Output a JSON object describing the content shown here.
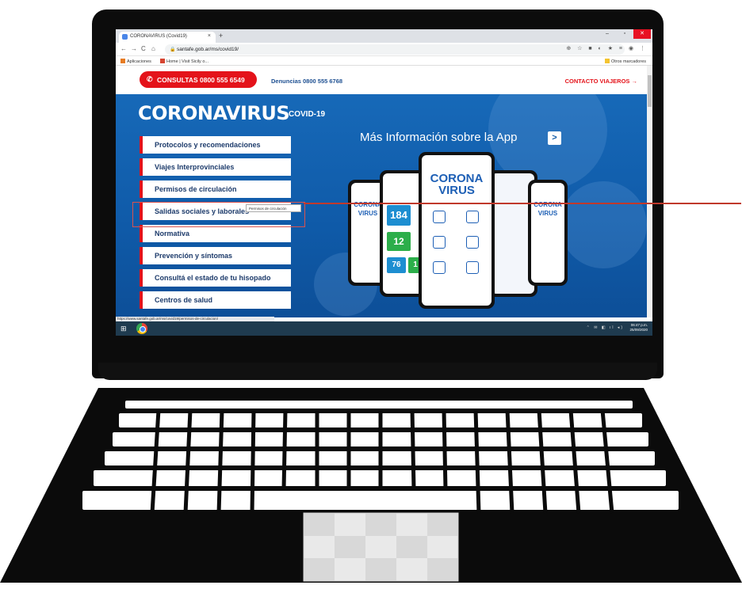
{
  "browser": {
    "tab_title": "CORONAVIRUS (Covid19)",
    "tab_close": "×",
    "new_tab": "+",
    "window_controls": {
      "minimize": "–",
      "maximize": "▫",
      "close": "✕"
    },
    "nav": {
      "back": "←",
      "forward": "→",
      "reload": "C",
      "home": "⌂"
    },
    "url": "santafe.gob.ar/ms/covid19/",
    "lock_glyph": "🔒",
    "toolbar_icons": "⊕ ☆ ■ ◐ ★ ≡ ◉ ⋮",
    "bookmarks": {
      "apps": "Aplicaciones",
      "home": "Home | Visit Sicily o...",
      "other": "Otros marcadores"
    },
    "status_url": "https://www.santafe.gob.ar/ms/covid19/permisos-de-circulacion/"
  },
  "page": {
    "consultas": "CONSULTAS 0800 555 6549",
    "phone_glyph": "✆",
    "denuncias": "Denuncias 0800 555 6768",
    "contacto": "CONTACTO VIAJEROS →",
    "brand": "CORONAVIRUS",
    "brand_sub": "COVID-19",
    "mas_info": "Más Información sobre la App",
    "mas_info_arrow": ">",
    "menu": [
      "Protocolos y recomendaciones",
      "Viajes Interprovinciales",
      "Permisos de circulación",
      "Salidas sociales y laborales",
      "Normativa",
      "Prevención y síntomas",
      "Consultá el estado de tu hisopado",
      "Centros de salud"
    ],
    "tooltip": "Permisos de circulación",
    "app": {
      "center_title_1": "CORONA",
      "center_title_2": "VIRUS",
      "left_title_1": "CORONA",
      "left_title_2": "VIRUS",
      "right_title_1": "CORONA",
      "right_title_2": "VIRUS",
      "stat_big": "184",
      "stat_mid": "12",
      "stat_low": "76",
      "stat_one": "1"
    }
  },
  "taskbar": {
    "start_glyph": "⊞",
    "tray": "⌃ ✉ ◧ ıl ◂)",
    "time": "06:47 p.m.",
    "date": "25/09/2020"
  },
  "colors": {
    "brand_red": "#e4131a",
    "brand_blue": "#0f5aa8",
    "menu_text": "#1d3b6b"
  }
}
